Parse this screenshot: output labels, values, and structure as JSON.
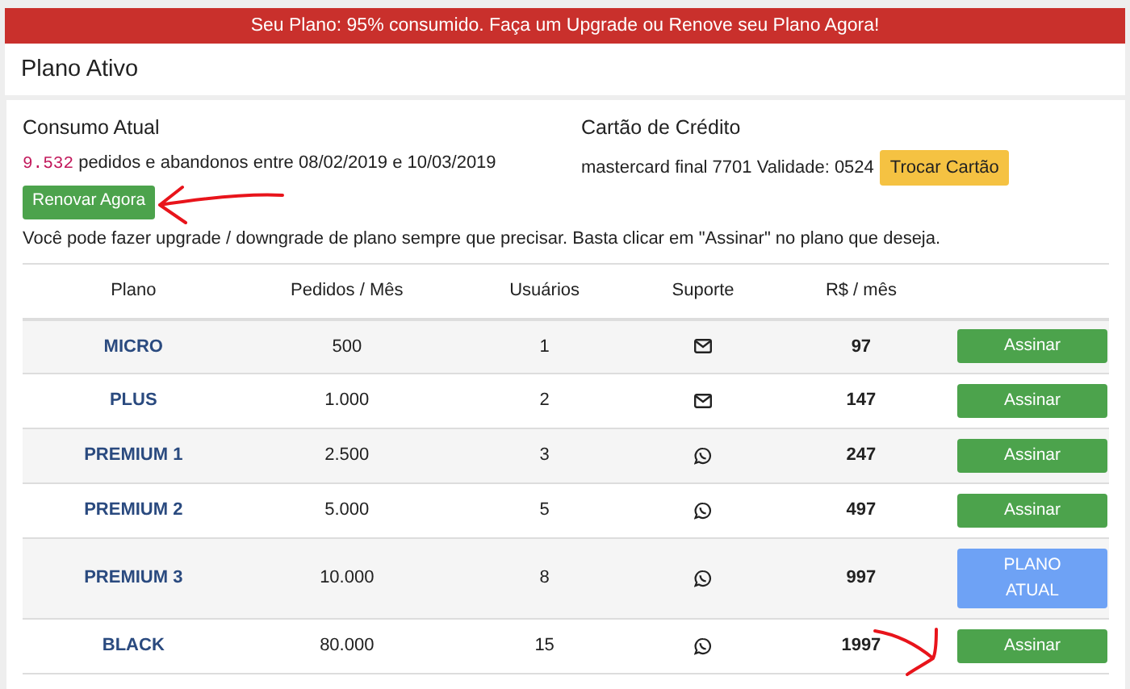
{
  "banner": "Seu Plano: 95% consumido. Faça um Upgrade ou Renove seu Plano Agora!",
  "title": "Plano Ativo",
  "consumption": {
    "heading": "Consumo Atual",
    "count": "9.532",
    "text": "pedidos e abandonos entre 08/02/2019 e 10/03/2019",
    "button": "Renovar Agora"
  },
  "card": {
    "heading": "Cartão de Crédito",
    "text": "mastercard final 7701 Validade: 0524",
    "button": "Trocar Cartão"
  },
  "note": "Você pode fazer upgrade / downgrade de plano sempre que precisar. Basta clicar em \"Assinar\" no plano que deseja.",
  "table": {
    "columns": [
      "Plano",
      "Pedidos / Mês",
      "Usuários",
      "Suporte",
      "R$ / mês"
    ],
    "rows": [
      {
        "plan": "MICRO",
        "orders": "500",
        "users": "1",
        "kind": "email",
        "price": "97",
        "button": "Assinar",
        "current": false
      },
      {
        "plan": "PLUS",
        "orders": "1.000",
        "users": "2",
        "kind": "email",
        "price": "147",
        "button": "Assinar",
        "current": false
      },
      {
        "plan": "PREMIUM 1",
        "orders": "2.500",
        "users": "3",
        "kind": "whatsapp",
        "price": "247",
        "button": "Assinar",
        "current": false
      },
      {
        "plan": "PREMIUM 2",
        "orders": "5.000",
        "users": "5",
        "kind": "whatsapp",
        "price": "497",
        "button": "Assinar",
        "current": false
      },
      {
        "plan": "PREMIUM 3",
        "orders": "10.000",
        "users": "8",
        "kind": "whatsapp",
        "price": "997",
        "button": "PLANO ATUAL",
        "current": true
      },
      {
        "plan": "BLACK",
        "orders": "80.000",
        "users": "15",
        "kind": "whatsapp",
        "price": "1997",
        "button": "Assinar",
        "current": false
      }
    ]
  }
}
